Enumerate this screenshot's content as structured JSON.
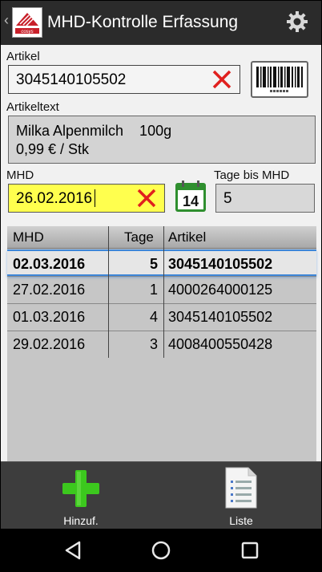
{
  "actionbar": {
    "title": "MHD-Kontrolle Erfassung"
  },
  "form": {
    "artikel_label": "Artikel",
    "artikel_value": "3045140105502",
    "artikeltext_label": "Artikeltext",
    "artikeltext_line1": "Milka Alpenmilch    100g",
    "artikeltext_line2": "0,99 € / Stk",
    "mhd_label": "MHD",
    "mhd_value": "26.02.2016",
    "tage_label": "Tage bis MHD",
    "tage_value": "5",
    "calendar_day": "14"
  },
  "table": {
    "headers": [
      "MHD",
      "Tage",
      "Artikel"
    ],
    "rows": [
      {
        "mhd": "02.03.2016",
        "tage": "5",
        "artikel": "3045140105502",
        "selected": true
      },
      {
        "mhd": "27.02.2016",
        "tage": "1",
        "artikel": "4000264000125",
        "selected": false
      },
      {
        "mhd": "01.03.2016",
        "tage": "4",
        "artikel": "3045140105502",
        "selected": false
      },
      {
        "mhd": "29.02.2016",
        "tage": "3",
        "artikel": "4008400550428",
        "selected": false
      }
    ]
  },
  "toolbar": {
    "add_label": "Hinzuf.",
    "list_label": "Liste"
  },
  "icons": {
    "logo": "app-logo-icon",
    "settings": "gear-icon",
    "clear": "close-x-icon",
    "barcode": "barcode-icon",
    "calendar": "calendar-icon",
    "add": "plus-icon",
    "list": "document-list-icon",
    "back": "nav-back-icon",
    "home": "nav-home-icon",
    "recents": "nav-recents-icon"
  },
  "colors": {
    "actionbar": "#2b2b2b",
    "clear_x": "#e0201e",
    "mhd_field": "#ffff4e",
    "selection": "#3d86d8",
    "add_icon": "#3cc81e",
    "toolbar": "#3d3d3d"
  }
}
